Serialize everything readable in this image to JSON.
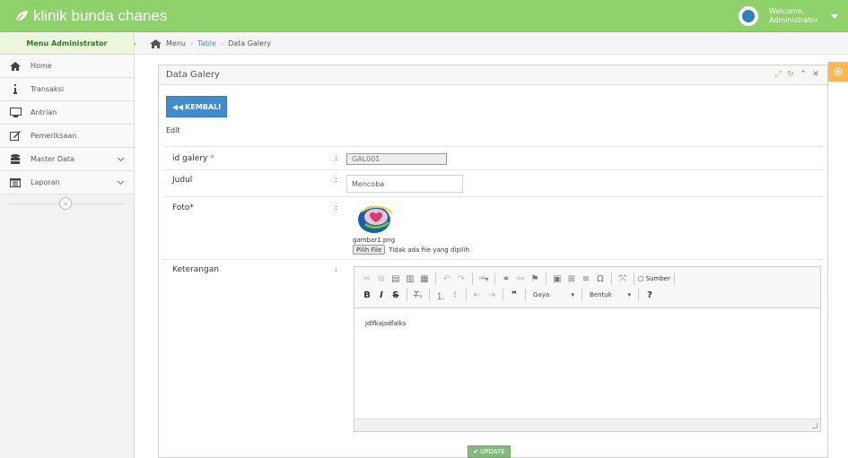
{
  "app": {
    "brand": "klinik bunda chanes"
  },
  "user": {
    "welcome": "Welcome,",
    "name": "Administrator"
  },
  "sidebar": {
    "header": "Menu Administrator",
    "items": [
      {
        "label": "Home",
        "icon": "home-icon"
      },
      {
        "label": "Transaksi",
        "icon": "info-icon"
      },
      {
        "label": "Antrian",
        "icon": "desktop-icon"
      },
      {
        "label": "Pemeriksaan",
        "icon": "edit-icon"
      },
      {
        "label": "Master Data",
        "icon": "database-icon"
      },
      {
        "label": "Laporan",
        "icon": "calendar-icon"
      }
    ],
    "collapse_glyph": "«"
  },
  "breadcrumb": {
    "items": [
      "Menu",
      "Table",
      "Data Galery"
    ]
  },
  "widget": {
    "title": "Data Galery"
  },
  "form": {
    "back_label": "KEMBALI",
    "section_label": "Edit",
    "id_label": "id galery",
    "id_required": "*",
    "id_value": "GAL001",
    "judul_label": "Judul",
    "judul_value": "Mencoba",
    "foto_label": "Foto*",
    "foto_filename": "gambar1.png",
    "file_button": "Pilih File",
    "file_status": "Tidak ada file yang dipilih",
    "keterangan_label": "Keterangan",
    "colon": ":",
    "editor_content": "jdlfkajsdfalks",
    "editor_format_combo": "Gaya",
    "editor_style_combo": "Bentuk",
    "editor_source_label": "Sumber",
    "update_label": "UPDATE"
  },
  "colors": {
    "navbar": "#8fd16a",
    "primary": "#428bca",
    "success": "#87b87f",
    "warning": "#ffb752"
  }
}
